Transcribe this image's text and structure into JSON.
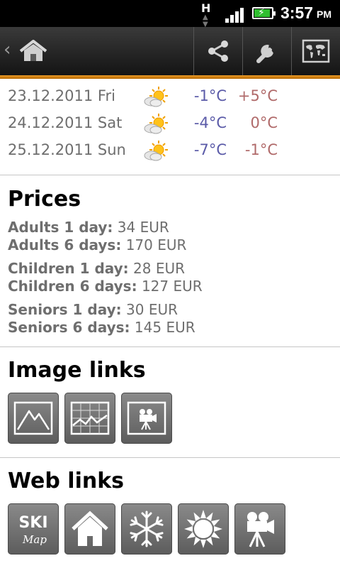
{
  "status_bar": {
    "network": "H",
    "time": "3:57",
    "ampm": "PM"
  },
  "forecast": [
    {
      "date": "23.12.2011 Fri",
      "min": "-1°C",
      "max": "+5°C",
      "icon": "partly-cloudy-sun-icon"
    },
    {
      "date": "24.12.2011 Sat",
      "min": "-4°C",
      "max": "0°C",
      "icon": "partly-cloudy-sun-icon"
    },
    {
      "date": "25.12.2011 Sun",
      "min": "-7°C",
      "max": "-1°C",
      "icon": "partly-cloudy-sun-icon"
    }
  ],
  "prices": {
    "title": "Prices",
    "items": [
      {
        "label": "Adults 1 day:",
        "value": "34 EUR"
      },
      {
        "label": "Adults 6 days:",
        "value": "170 EUR"
      },
      {
        "label": "Children 1 day:",
        "value": "28 EUR"
      },
      {
        "label": "Children 6 days:",
        "value": "127 EUR"
      },
      {
        "label": "Seniors 1 day:",
        "value": "30 EUR"
      },
      {
        "label": "Seniors 6 days:",
        "value": "145 EUR"
      }
    ]
  },
  "image_links": {
    "title": "Image links",
    "items": [
      "mountain-image-icon",
      "chart-image-icon",
      "webcam-image-icon"
    ]
  },
  "web_links": {
    "title": "Web links",
    "ski_map_line1": "SKI",
    "ski_map_line2": "Map",
    "items": [
      "ski-map-icon",
      "home-icon",
      "snowflake-icon",
      "sun-icon",
      "video-camera-icon"
    ]
  },
  "colors": {
    "accent": "#e08a1a",
    "min_temp": "#5b5ba8",
    "max_temp": "#b06a6a",
    "text_gray": "#6e6e6e"
  }
}
